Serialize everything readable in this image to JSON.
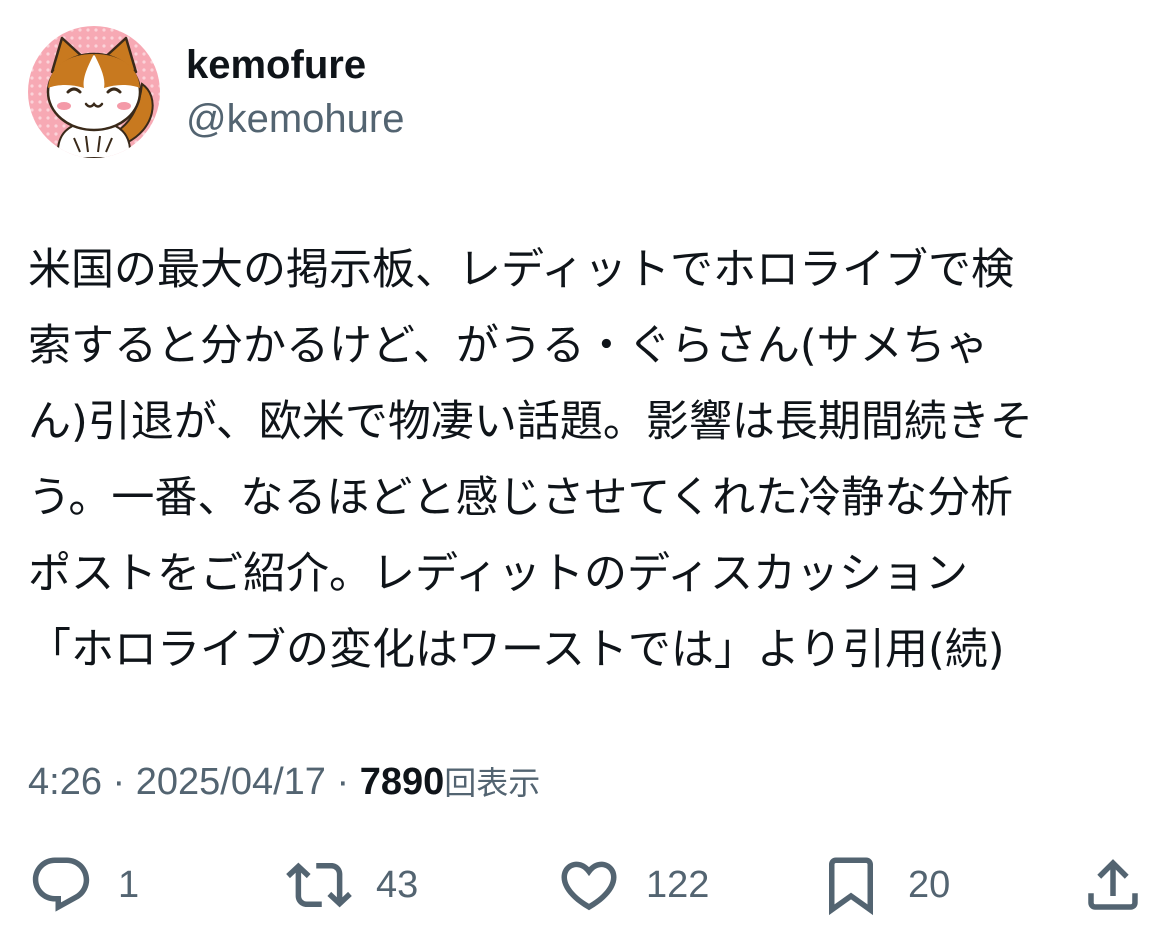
{
  "author": {
    "display_name": "kemofure",
    "handle": "@kemohure",
    "avatar_icon": "cat-avatar-icon"
  },
  "tweet": {
    "text": "米国の最大の掲示板、レディットでホロライブで検\n索すると分かるけど、がうる・ぐらさん(サメちゃ\nん)引退が、欧米で物凄い話題。影響は長期間続きそ\nう。一番、なるほどと感じさせてくれた冷静な分析\nポストをご紹介。レディットのディスカッション\n「ホロライブの変化はワーストでは」より引用(続)"
  },
  "meta": {
    "time": "4:26",
    "separator": "·",
    "date": "2025/04/17",
    "views_count": "7890",
    "views_label": "回表示"
  },
  "actions": {
    "reply_count": "1",
    "retweet_count": "43",
    "like_count": "122",
    "bookmark_count": "20"
  },
  "colors": {
    "text_primary": "#0f1419",
    "text_secondary": "#536471",
    "background": "#ffffff",
    "avatar_bg": "#f6a6b2"
  }
}
